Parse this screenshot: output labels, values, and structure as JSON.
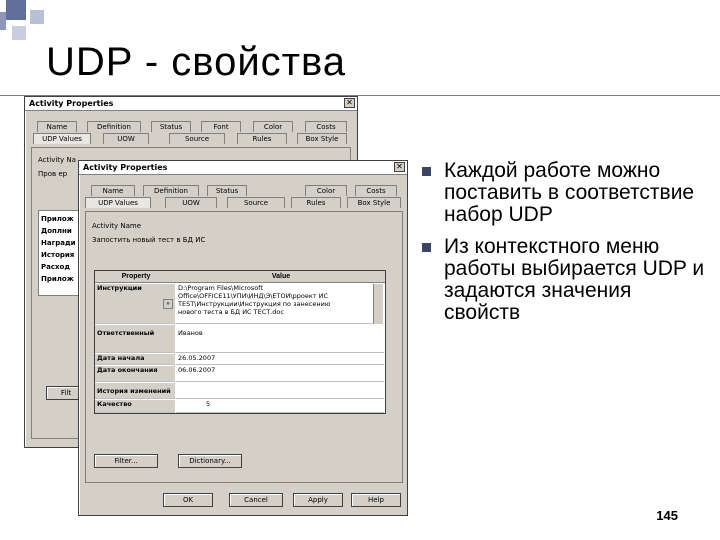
{
  "slide": {
    "title": "UDP  - свойства",
    "bullets": [
      "Каждой работе можно поставить в соответствие набор UDP",
      " Из контекстного меню работы выбирается UDP и задаются значения свойств"
    ],
    "page_number": "145"
  },
  "dialog_back": {
    "title": "Activity Properties",
    "tabs_row1": [
      "Name",
      "Definition",
      "Status",
      "Font",
      "Color",
      "Costs"
    ],
    "tabs_row2": [
      "UDP Values",
      "UOW",
      "Source",
      "Rules",
      "Box Style"
    ],
    "label1": "Activity Na",
    "label2": "Пров ер",
    "list_items": [
      "Прилож",
      "Доплни",
      "Награди",
      "История",
      "Расход",
      "Прилож"
    ],
    "filter_button": "Filt"
  },
  "dialog_front": {
    "title": "Activity Properties",
    "tabs_row1": [
      "Name",
      "Definition",
      "Status",
      "Color",
      "Costs"
    ],
    "tabs_row2": [
      "UDP Values",
      "UOW",
      "Source",
      "Rules",
      "Box Style"
    ],
    "activity_name_label": "Activity Name",
    "activity_name_value": "Запостить новый тест в БД ИС",
    "grid_headers": {
      "property": "Property",
      "value": "Value"
    },
    "grid_rows": [
      {
        "property": "Инструкции",
        "value": "D:\\Program Files\\Microsoft\nOffice\\OFFICE11\\УПИ\\ИНД\\Э\\ЕТОИ\\рроект ИС\nTEST\\Инструкции\\Инструкция по занесению\n нового теста в БД ИС ТЕСТ.doc"
      },
      {
        "property": "Ответственный",
        "value": "Иванов"
      },
      {
        "property": "Дата начала",
        "value": "26.05.2007"
      },
      {
        "property": "Дата окончания",
        "value": "06.06.2007"
      },
      {
        "property": "История изменений",
        "value": ""
      },
      {
        "property": "Качество",
        "value": "5"
      }
    ],
    "filter_button": "Filter...",
    "dictionary_button": "Dictionary...",
    "ok_button": "OK",
    "cancel_button": "Cancel",
    "apply_button": "Apply",
    "help_button": "Help"
  }
}
